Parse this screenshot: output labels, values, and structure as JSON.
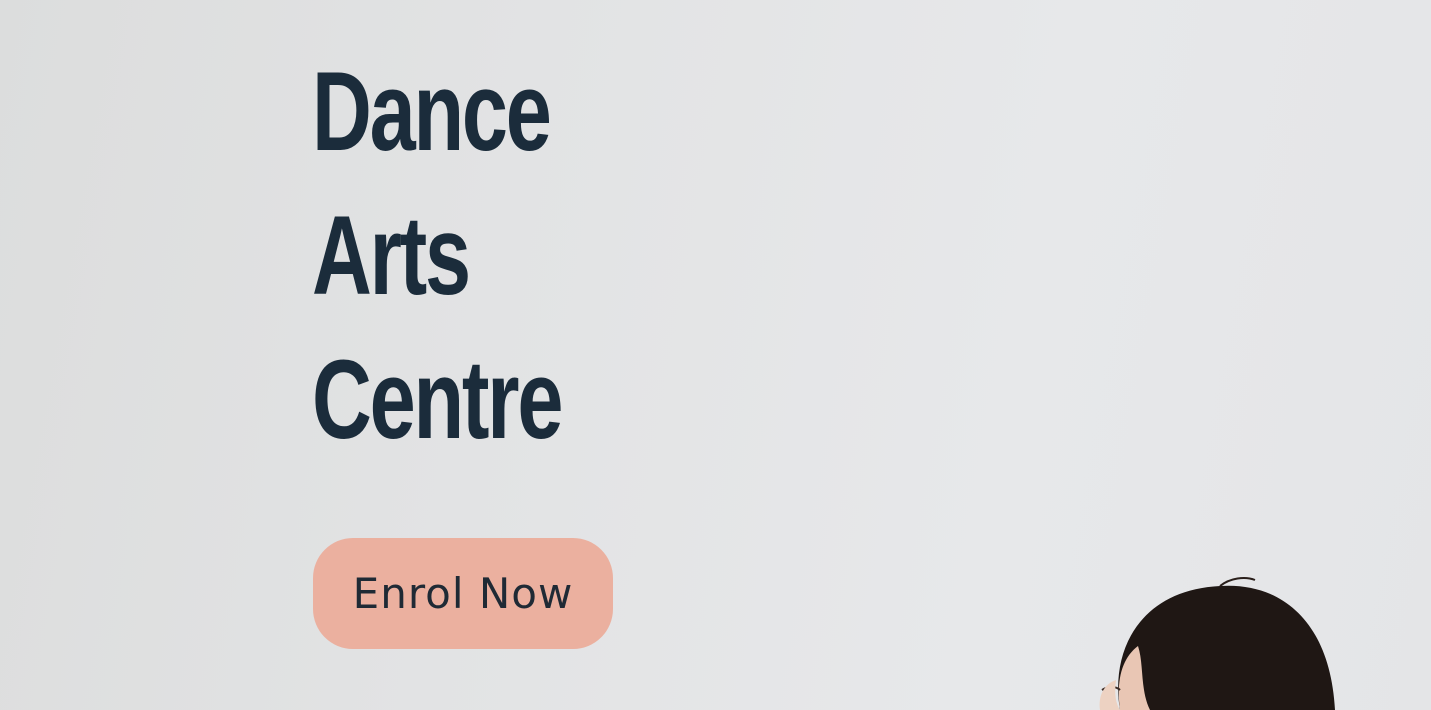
{
  "hero": {
    "title_lines": [
      "Dance",
      "Arts",
      "Centre"
    ],
    "cta_label": "Enrol Now"
  },
  "colors": {
    "title": "#1b2c3b",
    "cta_background": "#ebb09f",
    "cta_text": "#1f2a35"
  }
}
